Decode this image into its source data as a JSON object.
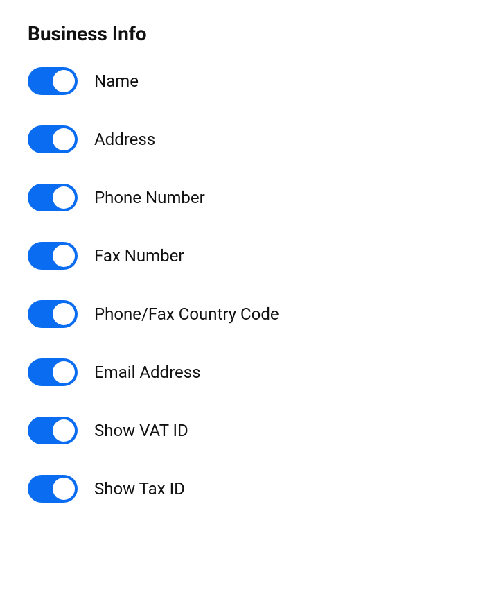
{
  "section": {
    "title": "Business Info",
    "toggles": [
      {
        "label": "Name",
        "on": true
      },
      {
        "label": "Address",
        "on": true
      },
      {
        "label": "Phone Number",
        "on": true
      },
      {
        "label": "Fax Number",
        "on": true
      },
      {
        "label": "Phone/Fax Country Code",
        "on": true
      },
      {
        "label": "Email Address",
        "on": true
      },
      {
        "label": "Show VAT ID",
        "on": true
      },
      {
        "label": "Show Tax ID",
        "on": true
      }
    ]
  },
  "colors": {
    "toggle_on": "#0a6cf0",
    "toggle_off": "#cccccc"
  }
}
